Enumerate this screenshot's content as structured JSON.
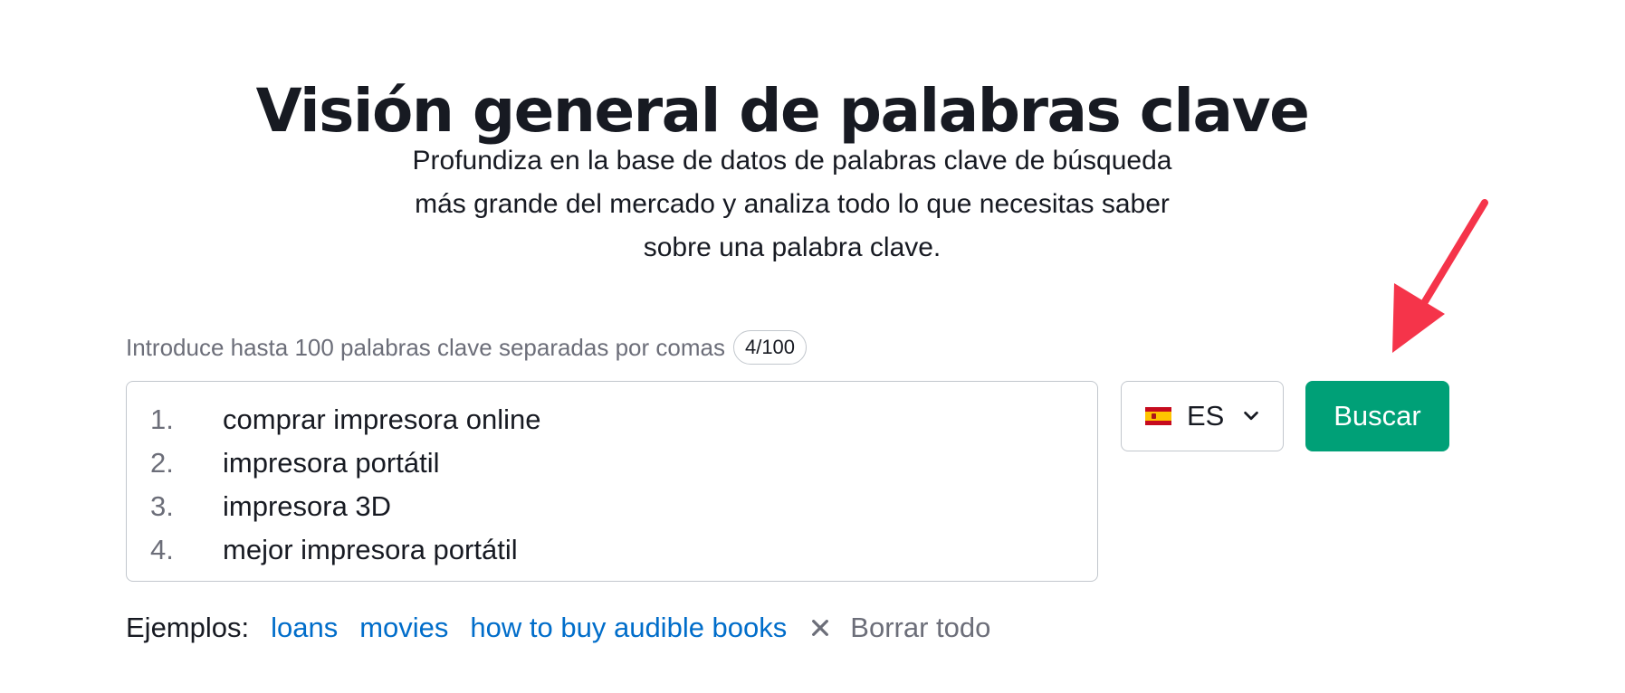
{
  "header": {
    "title": "Visión general de palabras clave",
    "subtitle_lines": [
      "Profundiza en la base de datos de palabras clave de búsqueda",
      "más grande del mercado y analiza todo lo que necesitas saber",
      "sobre una palabra clave."
    ]
  },
  "input": {
    "hint": "Introduce hasta 100 palabras clave separadas por comas",
    "counter": "4/100",
    "keywords": [
      {
        "num": "1.",
        "text": "comprar impresora online"
      },
      {
        "num": "2.",
        "text": "impresora portátil"
      },
      {
        "num": "3.",
        "text": "impresora 3D"
      },
      {
        "num": "4.",
        "text": "mejor impresora portátil"
      }
    ]
  },
  "database": {
    "selected": "ES",
    "flag_icon": "spain-flag-icon",
    "dropdown_icon": "chevron-down-icon"
  },
  "search_button": {
    "label": "Buscar",
    "color": "#00a077"
  },
  "examples": {
    "label": "Ejemplos:",
    "links": [
      "loans",
      "movies",
      "how to buy audible books"
    ],
    "clear_icon": "close-icon",
    "clear_label": "Borrar todo",
    "link_color": "#006dca"
  },
  "annotation": {
    "icon": "red-arrow-icon",
    "color": "#f5344a"
  }
}
